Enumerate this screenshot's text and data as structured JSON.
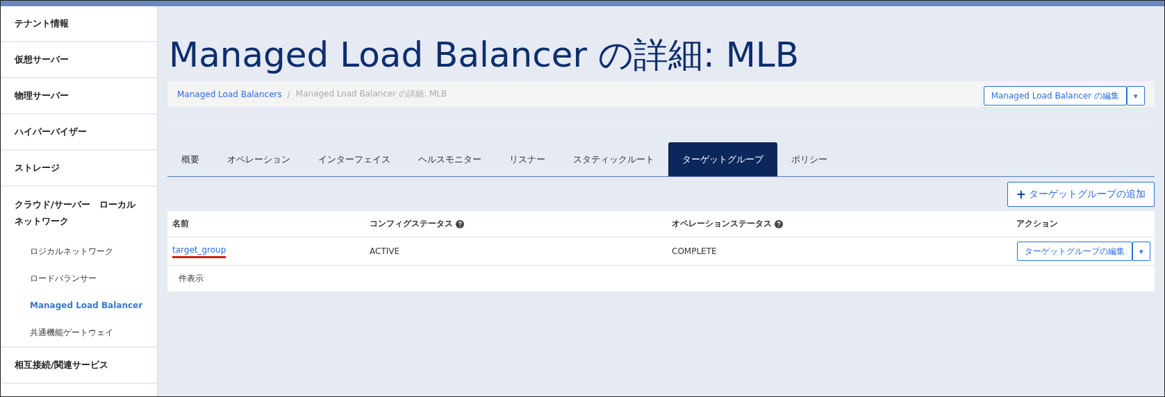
{
  "sidebar": {
    "items": [
      {
        "label": "テナント情報",
        "selected": false
      },
      {
        "label": "仮想サーバー",
        "selected": false
      },
      {
        "label": "物理サーバー",
        "selected": false
      },
      {
        "label": "ハイパーバイザー",
        "selected": false
      },
      {
        "label": "ストレージ",
        "selected": false
      },
      {
        "label": "クラウド/サーバー　ローカルネットワーク",
        "selected": false,
        "children": [
          {
            "label": "ロジカルネットワーク",
            "selected": false
          },
          {
            "label": "ロードバランサー",
            "selected": false
          },
          {
            "label": "Managed Load Balancer",
            "selected": true
          },
          {
            "label": "共通機能ゲートウェイ",
            "selected": false
          }
        ]
      },
      {
        "label": "相互接続/関連サービス",
        "selected": false
      }
    ]
  },
  "title": "Managed Load Balancer の詳細: MLB",
  "breadcrumb": [
    {
      "label": "Managed Load Balancers"
    },
    {
      "label": "Managed Load Balancer の詳細: MLB"
    }
  ],
  "breadcrumb_separator": "/",
  "edit_button": {
    "label": "Managed Load Balancer の編集",
    "caret": "▾"
  },
  "tabs": [
    {
      "label": "概要",
      "selected": false
    },
    {
      "label": "オペレーション",
      "selected": false
    },
    {
      "label": "インターフェイス",
      "selected": false
    },
    {
      "label": "ヘルスモニター",
      "selected": false
    },
    {
      "label": "リスナー",
      "selected": false
    },
    {
      "label": "スタティックルート",
      "selected": false
    },
    {
      "label": "ターゲットグループ",
      "selected": true
    },
    {
      "label": "ポリシー",
      "selected": false
    }
  ],
  "add_button": {
    "icon": "+",
    "label": "ターゲットグループの追加"
  },
  "table": {
    "columns": [
      {
        "label": "名前",
        "help": false
      },
      {
        "label": "コンフィグステータス",
        "help": true
      },
      {
        "label": "オペレーションステータス",
        "help": true
      },
      {
        "label": "アクション",
        "help": false
      }
    ],
    "rows": [
      {
        "name": "target_group",
        "underlined": true,
        "config_status": "ACTIVE",
        "operation_status": "COMPLETE",
        "action": "ターゲットグループの編集",
        "caret": "▾"
      }
    ],
    "footer": "件表示"
  }
}
